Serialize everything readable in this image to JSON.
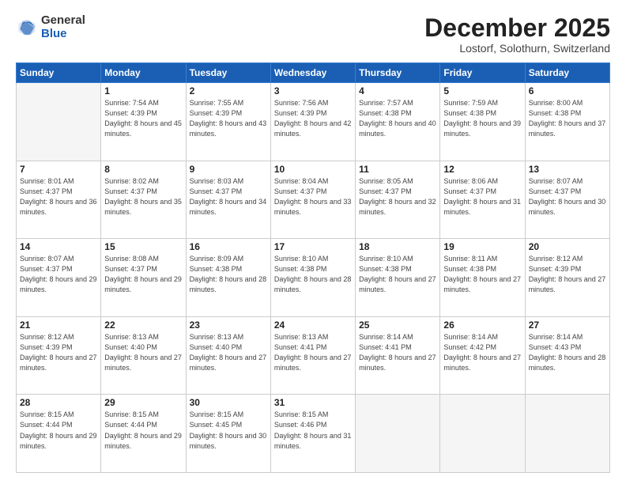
{
  "logo": {
    "general": "General",
    "blue": "Blue"
  },
  "header": {
    "month": "December 2025",
    "location": "Lostorf, Solothurn, Switzerland"
  },
  "weekdays": [
    "Sunday",
    "Monday",
    "Tuesday",
    "Wednesday",
    "Thursday",
    "Friday",
    "Saturday"
  ],
  "weeks": [
    [
      {
        "day": "",
        "sunrise": "",
        "sunset": "",
        "daylight": ""
      },
      {
        "day": "1",
        "sunrise": "Sunrise: 7:54 AM",
        "sunset": "Sunset: 4:39 PM",
        "daylight": "Daylight: 8 hours and 45 minutes."
      },
      {
        "day": "2",
        "sunrise": "Sunrise: 7:55 AM",
        "sunset": "Sunset: 4:39 PM",
        "daylight": "Daylight: 8 hours and 43 minutes."
      },
      {
        "day": "3",
        "sunrise": "Sunrise: 7:56 AM",
        "sunset": "Sunset: 4:39 PM",
        "daylight": "Daylight: 8 hours and 42 minutes."
      },
      {
        "day": "4",
        "sunrise": "Sunrise: 7:57 AM",
        "sunset": "Sunset: 4:38 PM",
        "daylight": "Daylight: 8 hours and 40 minutes."
      },
      {
        "day": "5",
        "sunrise": "Sunrise: 7:59 AM",
        "sunset": "Sunset: 4:38 PM",
        "daylight": "Daylight: 8 hours and 39 minutes."
      },
      {
        "day": "6",
        "sunrise": "Sunrise: 8:00 AM",
        "sunset": "Sunset: 4:38 PM",
        "daylight": "Daylight: 8 hours and 37 minutes."
      }
    ],
    [
      {
        "day": "7",
        "sunrise": "Sunrise: 8:01 AM",
        "sunset": "Sunset: 4:37 PM",
        "daylight": "Daylight: 8 hours and 36 minutes."
      },
      {
        "day": "8",
        "sunrise": "Sunrise: 8:02 AM",
        "sunset": "Sunset: 4:37 PM",
        "daylight": "Daylight: 8 hours and 35 minutes."
      },
      {
        "day": "9",
        "sunrise": "Sunrise: 8:03 AM",
        "sunset": "Sunset: 4:37 PM",
        "daylight": "Daylight: 8 hours and 34 minutes."
      },
      {
        "day": "10",
        "sunrise": "Sunrise: 8:04 AM",
        "sunset": "Sunset: 4:37 PM",
        "daylight": "Daylight: 8 hours and 33 minutes."
      },
      {
        "day": "11",
        "sunrise": "Sunrise: 8:05 AM",
        "sunset": "Sunset: 4:37 PM",
        "daylight": "Daylight: 8 hours and 32 minutes."
      },
      {
        "day": "12",
        "sunrise": "Sunrise: 8:06 AM",
        "sunset": "Sunset: 4:37 PM",
        "daylight": "Daylight: 8 hours and 31 minutes."
      },
      {
        "day": "13",
        "sunrise": "Sunrise: 8:07 AM",
        "sunset": "Sunset: 4:37 PM",
        "daylight": "Daylight: 8 hours and 30 minutes."
      }
    ],
    [
      {
        "day": "14",
        "sunrise": "Sunrise: 8:07 AM",
        "sunset": "Sunset: 4:37 PM",
        "daylight": "Daylight: 8 hours and 29 minutes."
      },
      {
        "day": "15",
        "sunrise": "Sunrise: 8:08 AM",
        "sunset": "Sunset: 4:37 PM",
        "daylight": "Daylight: 8 hours and 29 minutes."
      },
      {
        "day": "16",
        "sunrise": "Sunrise: 8:09 AM",
        "sunset": "Sunset: 4:38 PM",
        "daylight": "Daylight: 8 hours and 28 minutes."
      },
      {
        "day": "17",
        "sunrise": "Sunrise: 8:10 AM",
        "sunset": "Sunset: 4:38 PM",
        "daylight": "Daylight: 8 hours and 28 minutes."
      },
      {
        "day": "18",
        "sunrise": "Sunrise: 8:10 AM",
        "sunset": "Sunset: 4:38 PM",
        "daylight": "Daylight: 8 hours and 27 minutes."
      },
      {
        "day": "19",
        "sunrise": "Sunrise: 8:11 AM",
        "sunset": "Sunset: 4:38 PM",
        "daylight": "Daylight: 8 hours and 27 minutes."
      },
      {
        "day": "20",
        "sunrise": "Sunrise: 8:12 AM",
        "sunset": "Sunset: 4:39 PM",
        "daylight": "Daylight: 8 hours and 27 minutes."
      }
    ],
    [
      {
        "day": "21",
        "sunrise": "Sunrise: 8:12 AM",
        "sunset": "Sunset: 4:39 PM",
        "daylight": "Daylight: 8 hours and 27 minutes."
      },
      {
        "day": "22",
        "sunrise": "Sunrise: 8:13 AM",
        "sunset": "Sunset: 4:40 PM",
        "daylight": "Daylight: 8 hours and 27 minutes."
      },
      {
        "day": "23",
        "sunrise": "Sunrise: 8:13 AM",
        "sunset": "Sunset: 4:40 PM",
        "daylight": "Daylight: 8 hours and 27 minutes."
      },
      {
        "day": "24",
        "sunrise": "Sunrise: 8:13 AM",
        "sunset": "Sunset: 4:41 PM",
        "daylight": "Daylight: 8 hours and 27 minutes."
      },
      {
        "day": "25",
        "sunrise": "Sunrise: 8:14 AM",
        "sunset": "Sunset: 4:41 PM",
        "daylight": "Daylight: 8 hours and 27 minutes."
      },
      {
        "day": "26",
        "sunrise": "Sunrise: 8:14 AM",
        "sunset": "Sunset: 4:42 PM",
        "daylight": "Daylight: 8 hours and 27 minutes."
      },
      {
        "day": "27",
        "sunrise": "Sunrise: 8:14 AM",
        "sunset": "Sunset: 4:43 PM",
        "daylight": "Daylight: 8 hours and 28 minutes."
      }
    ],
    [
      {
        "day": "28",
        "sunrise": "Sunrise: 8:15 AM",
        "sunset": "Sunset: 4:44 PM",
        "daylight": "Daylight: 8 hours and 29 minutes."
      },
      {
        "day": "29",
        "sunrise": "Sunrise: 8:15 AM",
        "sunset": "Sunset: 4:44 PM",
        "daylight": "Daylight: 8 hours and 29 minutes."
      },
      {
        "day": "30",
        "sunrise": "Sunrise: 8:15 AM",
        "sunset": "Sunset: 4:45 PM",
        "daylight": "Daylight: 8 hours and 30 minutes."
      },
      {
        "day": "31",
        "sunrise": "Sunrise: 8:15 AM",
        "sunset": "Sunset: 4:46 PM",
        "daylight": "Daylight: 8 hours and 31 minutes."
      },
      {
        "day": "",
        "sunrise": "",
        "sunset": "",
        "daylight": ""
      },
      {
        "day": "",
        "sunrise": "",
        "sunset": "",
        "daylight": ""
      },
      {
        "day": "",
        "sunrise": "",
        "sunset": "",
        "daylight": ""
      }
    ]
  ]
}
